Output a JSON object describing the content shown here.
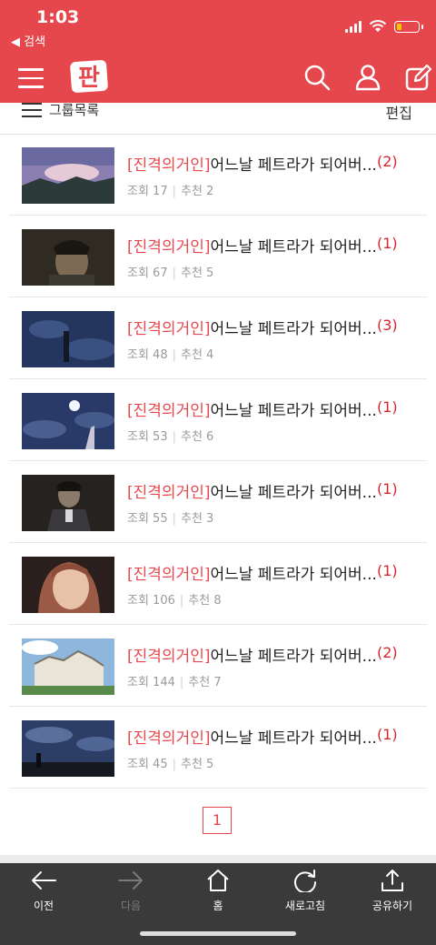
{
  "status_bar": {
    "time": "1:03",
    "back_label": "◀ 검색"
  },
  "nav": {
    "logo_text": "판"
  },
  "subbar": {
    "group_label": "그룹목록",
    "edit_label": "편집"
  },
  "items": [
    {
      "tag": "[진격의거인]",
      "title": "어느날 페트라가 되어버...",
      "comments": "(2)",
      "views": "조회 17",
      "recs": "추천 2"
    },
    {
      "tag": "[진격의거인]",
      "title": "어느날 페트라가 되어버...",
      "comments": "(1)",
      "views": "조회 67",
      "recs": "추천 5"
    },
    {
      "tag": "[진격의거인]",
      "title": "어느날 페트라가 되어버...",
      "comments": "(3)",
      "views": "조회 48",
      "recs": "추천 4"
    },
    {
      "tag": "[진격의거인]",
      "title": "어느날 페트라가 되어버...",
      "comments": "(1)",
      "views": "조회 53",
      "recs": "추천 6"
    },
    {
      "tag": "[진격의거인]",
      "title": "어느날 페트라가 되어버...",
      "comments": "(1)",
      "views": "조회 55",
      "recs": "추천 3"
    },
    {
      "tag": "[진격의거인]",
      "title": "어느날 페트라가 되어버...",
      "comments": "(1)",
      "views": "조회 106",
      "recs": "추천 8"
    },
    {
      "tag": "[진격의거인]",
      "title": "어느날 페트라가 되어버...",
      "comments": "(2)",
      "views": "조회 144",
      "recs": "추천 7"
    },
    {
      "tag": "[진격의거인]",
      "title": "어느날 페트라가 되어버...",
      "comments": "(1)",
      "views": "조회 45",
      "recs": "추천 5"
    }
  ],
  "pagination": {
    "current": "1"
  },
  "bottom_bar": {
    "prev": "이전",
    "next": "다음",
    "home": "홈",
    "refresh": "새로고침",
    "share": "공유하기"
  },
  "colors": {
    "accent": "#e5474d",
    "tag": "#e6484e",
    "comment": "#d6262d",
    "bottom_bar": "#3a3a3a"
  }
}
